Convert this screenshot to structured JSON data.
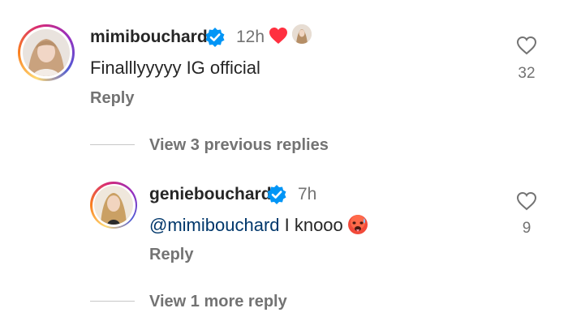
{
  "comment1": {
    "username": "mimibouchard",
    "time": "12h",
    "text": "Finalllyyyyy IG official",
    "reply_label": "Reply",
    "like_count": "32"
  },
  "view_previous": "View 3 previous replies",
  "reply1": {
    "username": "geniebouchard",
    "time": "7h",
    "mention": "@mimibouchard",
    "text": " I knooo",
    "reply_label": "Reply",
    "like_count": "9"
  },
  "view_more": "View 1 more reply",
  "colors": {
    "verified": "#0095f6",
    "heart_red": "#ff3040",
    "secondary_text": "#737373",
    "mention": "#00376b"
  }
}
